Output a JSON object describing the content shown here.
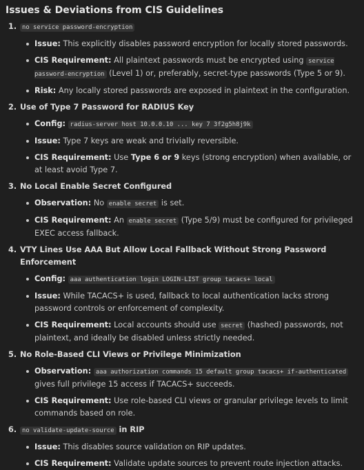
{
  "heading": "Issues & Deviations from CIS Guidelines",
  "items": [
    {
      "number": "1.",
      "title_code": "no service password-encryption",
      "points": [
        {
          "label": "Issue:",
          "text": "This explicitly disables password encryption for locally stored passwords."
        },
        {
          "label": "CIS Requirement:",
          "pre": "All plaintext passwords must be encrypted using",
          "code": "service password-encryption",
          "post": "(Level 1) or, preferably, secret-type passwords (Type 5 or 9)."
        },
        {
          "label": "Risk:",
          "text": "Any locally stored passwords are exposed in plaintext in the configuration."
        }
      ]
    },
    {
      "number": "2.",
      "title": "Use of Type 7 Password for RADIUS Key",
      "points": [
        {
          "label": "Config:",
          "code": "radius-server host 10.0.0.10 ... key 7 3f2g5h8j9k"
        },
        {
          "label": "Issue:",
          "text": "Type 7 keys are weak and trivially reversible."
        },
        {
          "label": "CIS Requirement:",
          "text": "Use",
          "bold": "Type 6 or 9",
          "post": "keys (strong encryption) when available, or at least avoid Type 7."
        }
      ]
    },
    {
      "number": "3.",
      "title": "No Local Enable Secret Configured",
      "points": [
        {
          "label": "Observation:",
          "pre": "No",
          "code": "enable secret",
          "post": "is set."
        },
        {
          "label": "CIS Requirement:",
          "pre": "An",
          "code": "enable secret",
          "post": "(Type 5/9) must be configured for privileged EXEC access fallback."
        }
      ]
    },
    {
      "number": "4.",
      "title": "VTY Lines Use AAA But Allow Local Fallback Without Strong Password Enforcement",
      "points": [
        {
          "label": "Config:",
          "code": "aaa authentication login LOGIN-LIST group tacacs+ local"
        },
        {
          "label": "Issue:",
          "text": "While TACACS+ is used, fallback to local authentication lacks strong password controls or enforcement of complexity."
        },
        {
          "label": "CIS Requirement:",
          "pre": "Local accounts should use",
          "code": "secret",
          "post": "(hashed) passwords, not plaintext, and ideally be disabled unless strictly needed."
        }
      ]
    },
    {
      "number": "5.",
      "title": "No Role-Based CLI Views or Privilege Minimization",
      "points": [
        {
          "label": "Observation:",
          "code": "aaa authorization commands 15 default group tacacs+ if-authenticated",
          "post": "gives full privilege 15 access if TACACS+ succeeds."
        },
        {
          "label": "CIS Requirement:",
          "text": "Use role-based CLI views or granular privilege levels to limit commands based on role."
        }
      ]
    },
    {
      "number": "6.",
      "title_code": "no validate-update-source",
      "title_suffix": "in RIP",
      "points": [
        {
          "label": "Issue:",
          "text": "This disables source validation on RIP updates."
        },
        {
          "label": "CIS Requirement:",
          "text": "Validate update sources to prevent route injection attacks."
        }
      ]
    }
  ]
}
